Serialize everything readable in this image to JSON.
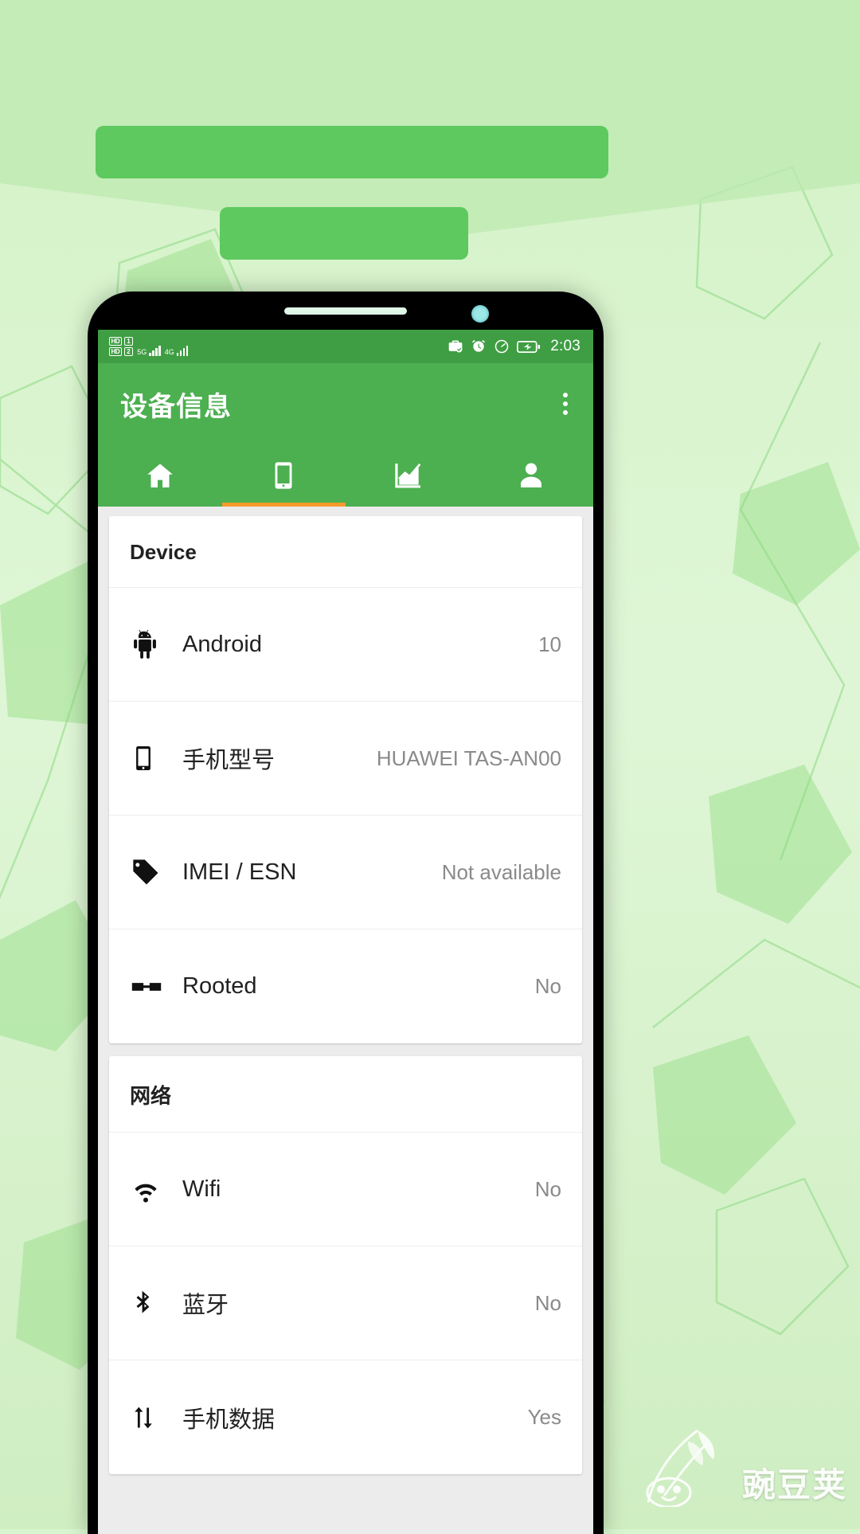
{
  "promo": {
    "bar_1": "",
    "bar_2": ""
  },
  "colors": {
    "app_bar": "#4caf50",
    "status_bar": "#3f9e43",
    "tab_indicator": "#f79a2b",
    "background": "#d9f3ce",
    "value_text": "#8a8a8a"
  },
  "status_bar": {
    "hd_badge_1": "HD",
    "sim_badge_1": "1",
    "hd_badge_2": "HD",
    "sim_badge_2": "2",
    "network_1": "5G",
    "network_2": "4G",
    "time": "2:03",
    "icons": [
      "work-profile-icon",
      "alarm-icon",
      "data-saver-icon",
      "battery-charging-icon"
    ]
  },
  "app_bar": {
    "title": "设备信息",
    "overflow_label": "more-options"
  },
  "tabs": [
    {
      "name": "tab-home",
      "icon": "home-icon",
      "active": false
    },
    {
      "name": "tab-device",
      "icon": "phone-icon",
      "active": true
    },
    {
      "name": "tab-stats",
      "icon": "chart-icon",
      "active": false
    },
    {
      "name": "tab-profile",
      "icon": "person-icon",
      "active": false
    }
  ],
  "sections": [
    {
      "title": "Device",
      "rows": [
        {
          "icon": "android-icon",
          "label": "Android",
          "value": "10"
        },
        {
          "icon": "phone-icon",
          "label": "手机型号",
          "value": "HUAWEI TAS-AN00"
        },
        {
          "icon": "tag-icon",
          "label": "IMEI / ESN",
          "value": "Not available"
        },
        {
          "icon": "glasses-icon",
          "label": "Rooted",
          "value": "No"
        }
      ]
    },
    {
      "title": "网络",
      "rows": [
        {
          "icon": "wifi-icon",
          "label": "Wifi",
          "value": "No"
        },
        {
          "icon": "bluetooth-icon",
          "label": "蓝牙",
          "value": "No"
        },
        {
          "icon": "data-icon",
          "label": "手机数据",
          "value": "Yes"
        }
      ]
    }
  ],
  "watermark": {
    "text": "豌豆荚"
  }
}
